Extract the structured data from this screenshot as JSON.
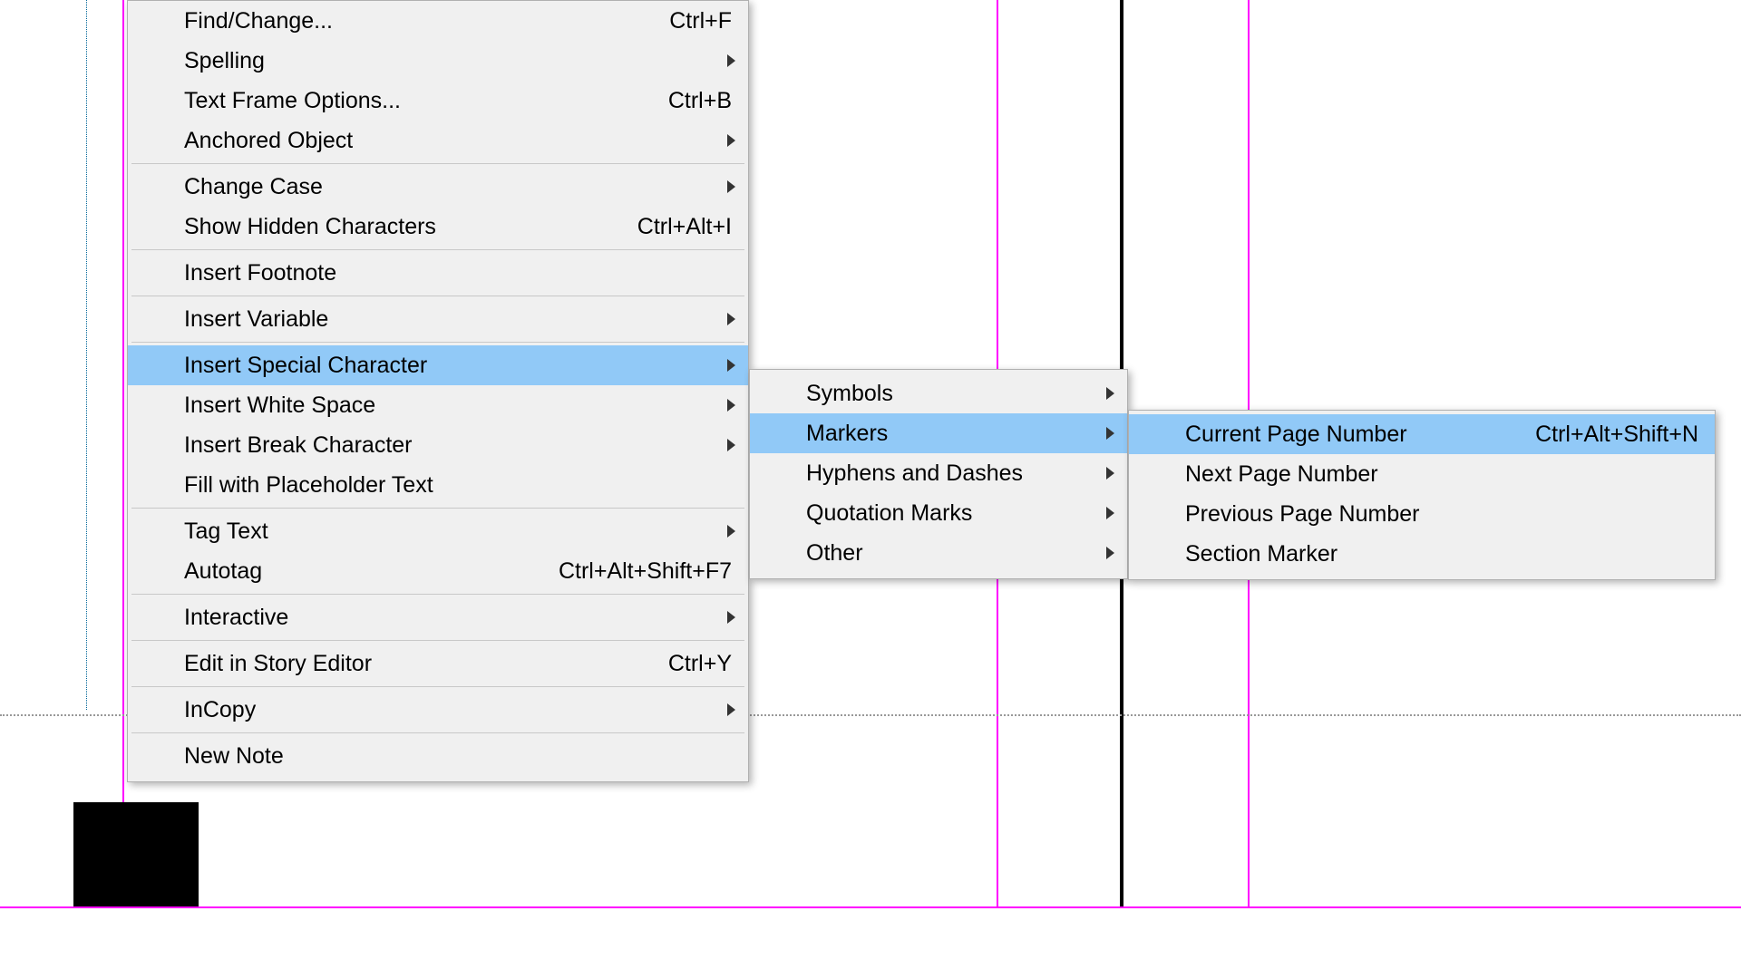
{
  "mainMenu": {
    "items": [
      {
        "label": "Find/Change...",
        "shortcut": "Ctrl+F",
        "hasSubmenu": false,
        "highlighted": false
      },
      {
        "label": "Spelling",
        "shortcut": "",
        "hasSubmenu": true,
        "highlighted": false
      },
      {
        "label": "Text Frame Options...",
        "shortcut": "Ctrl+B",
        "hasSubmenu": false,
        "highlighted": false
      },
      {
        "label": "Anchored Object",
        "shortcut": "",
        "hasSubmenu": true,
        "highlighted": false
      },
      {
        "label": "Change Case",
        "shortcut": "",
        "hasSubmenu": true,
        "highlighted": false,
        "sepBefore": true
      },
      {
        "label": "Show Hidden Characters",
        "shortcut": "Ctrl+Alt+I",
        "hasSubmenu": false,
        "highlighted": false
      },
      {
        "label": "Insert Footnote",
        "shortcut": "",
        "hasSubmenu": false,
        "highlighted": false,
        "sepBefore": true
      },
      {
        "label": "Insert Variable",
        "shortcut": "",
        "hasSubmenu": true,
        "highlighted": false,
        "sepBefore": true
      },
      {
        "label": "Insert Special Character",
        "shortcut": "",
        "hasSubmenu": true,
        "highlighted": true,
        "sepBefore": true
      },
      {
        "label": "Insert White Space",
        "shortcut": "",
        "hasSubmenu": true,
        "highlighted": false
      },
      {
        "label": "Insert Break Character",
        "shortcut": "",
        "hasSubmenu": true,
        "highlighted": false
      },
      {
        "label": "Fill with Placeholder Text",
        "shortcut": "",
        "hasSubmenu": false,
        "highlighted": false
      },
      {
        "label": "Tag Text",
        "shortcut": "",
        "hasSubmenu": true,
        "highlighted": false,
        "sepBefore": true
      },
      {
        "label": "Autotag",
        "shortcut": "Ctrl+Alt+Shift+F7",
        "hasSubmenu": false,
        "highlighted": false
      },
      {
        "label": "Interactive",
        "shortcut": "",
        "hasSubmenu": true,
        "highlighted": false,
        "sepBefore": true
      },
      {
        "label": "Edit in Story Editor",
        "shortcut": "Ctrl+Y",
        "hasSubmenu": false,
        "highlighted": false,
        "sepBefore": true
      },
      {
        "label": "InCopy",
        "shortcut": "",
        "hasSubmenu": true,
        "highlighted": false,
        "sepBefore": true
      },
      {
        "label": "New Note",
        "shortcut": "",
        "hasSubmenu": false,
        "highlighted": false,
        "sepBefore": true
      }
    ]
  },
  "subMenu1": {
    "items": [
      {
        "label": "Symbols",
        "shortcut": "",
        "hasSubmenu": true,
        "highlighted": false
      },
      {
        "label": "Markers",
        "shortcut": "",
        "hasSubmenu": true,
        "highlighted": true
      },
      {
        "label": "Hyphens and Dashes",
        "shortcut": "",
        "hasSubmenu": true,
        "highlighted": false
      },
      {
        "label": "Quotation Marks",
        "shortcut": "",
        "hasSubmenu": true,
        "highlighted": false
      },
      {
        "label": "Other",
        "shortcut": "",
        "hasSubmenu": true,
        "highlighted": false
      }
    ]
  },
  "subMenu2": {
    "items": [
      {
        "label": "Current Page Number",
        "shortcut": "Ctrl+Alt+Shift+N",
        "hasSubmenu": false,
        "highlighted": true
      },
      {
        "label": "Next Page Number",
        "shortcut": "",
        "hasSubmenu": false,
        "highlighted": false
      },
      {
        "label": "Previous Page Number",
        "shortcut": "",
        "hasSubmenu": false,
        "highlighted": false
      },
      {
        "label": "Section Marker",
        "shortcut": "",
        "hasSubmenu": false,
        "highlighted": false
      }
    ]
  }
}
